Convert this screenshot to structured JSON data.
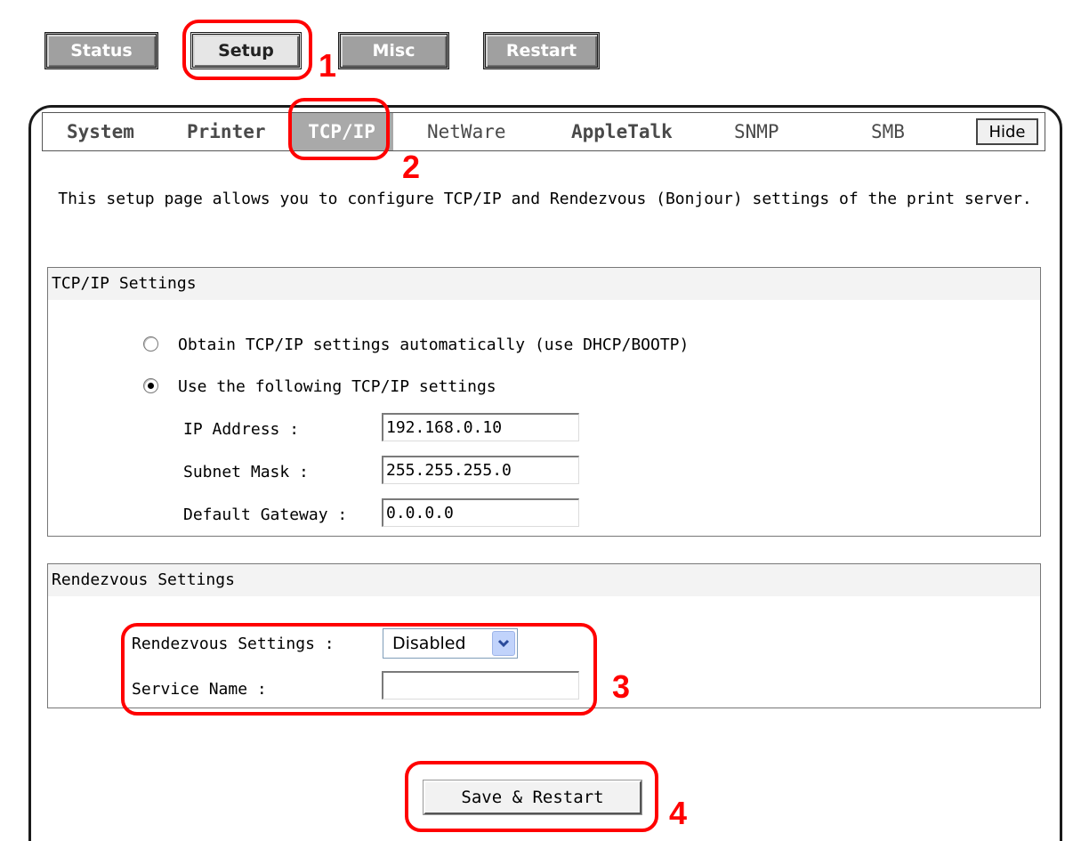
{
  "top_nav": {
    "status": "Status",
    "setup": "Setup",
    "misc": "Misc",
    "restart": "Restart"
  },
  "tabs": {
    "system": "System",
    "printer": "Printer",
    "tcpip": "TCP/IP",
    "netware": "NetWare",
    "appletalk": "AppleTalk",
    "snmp": "SNMP",
    "smb": "SMB",
    "hide": "Hide"
  },
  "description": "This setup page allows you to configure TCP/IP and Rendezvous (Bonjour) settings of the print server.",
  "tcpip_settings": {
    "title": "TCP/IP Settings",
    "option_auto": "Obtain TCP/IP settings automatically (use DHCP/BOOTP)",
    "option_manual": "Use the following TCP/IP settings",
    "selected_option": "manual",
    "ip_label": "IP Address :",
    "ip_value": "192.168.0.10",
    "subnet_label": "Subnet Mask :",
    "subnet_value": "255.255.255.0",
    "gateway_label": "Default Gateway :",
    "gateway_value": "0.0.0.0"
  },
  "rendezvous_settings": {
    "title": "Rendezvous Settings",
    "setting_label": "Rendezvous Settings :",
    "setting_value": "Disabled",
    "service_label": "Service Name :",
    "service_value": ""
  },
  "save_button": "Save & Restart",
  "annotations": {
    "step1": "1",
    "step2": "2",
    "step3": "3",
    "step4": "4",
    "color": "#ff0000"
  },
  "colors": {
    "active_tab": "#a9a9a9",
    "nav_button": "#a0a0a0"
  },
  "icons": {
    "select_arrow": "chevron-down-icon"
  }
}
